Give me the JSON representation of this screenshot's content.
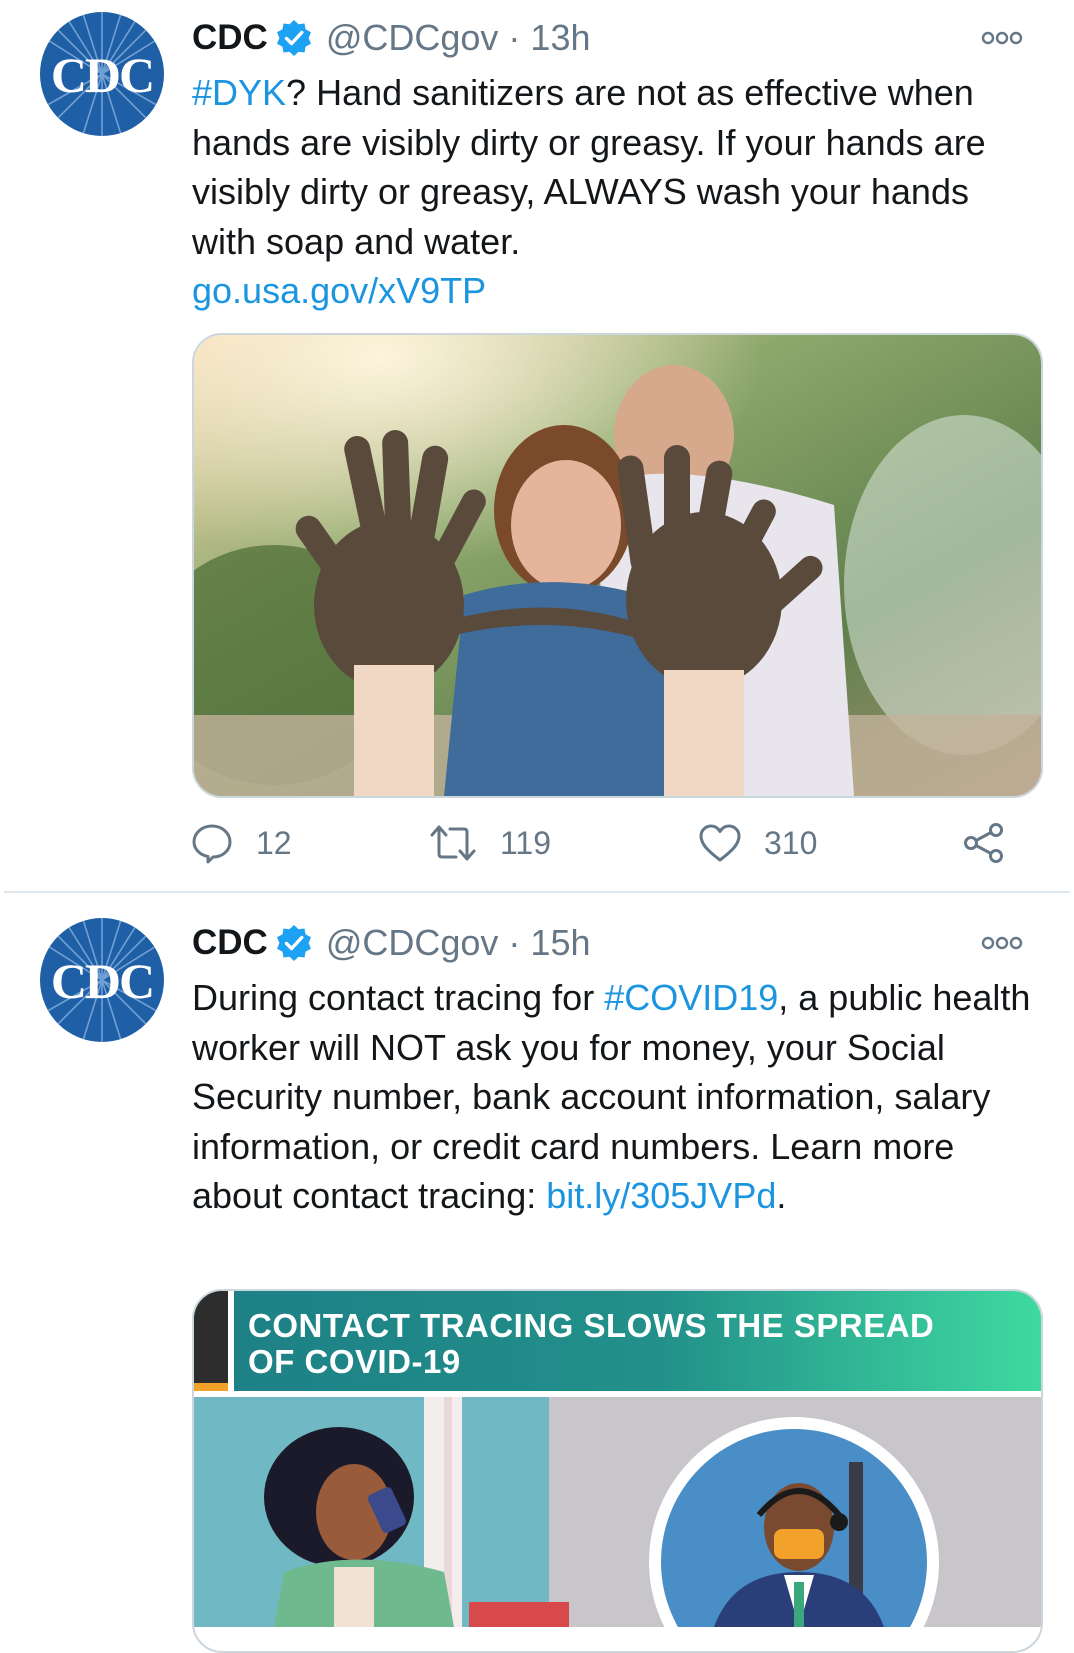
{
  "tweets": [
    {
      "author": {
        "name": "CDC",
        "handle": "@CDCgov",
        "avatar_label": "CDC",
        "verified": true
      },
      "time": "13h",
      "text_parts": {
        "hashtag": "#DYK",
        "rest": "? Hand sanitizers are not as effective when hands are visibly dirty or greasy. If your hands are visibly dirty or greasy, ALWAYS wash your hands with soap and water."
      },
      "link": "go.usa.gov/xV9TP",
      "media": {
        "kind": "photo",
        "description_icon": "muddy-hands-photo"
      },
      "stats": {
        "replies": "12",
        "retweets": "119",
        "likes": "310"
      }
    },
    {
      "author": {
        "name": "CDC",
        "handle": "@CDCgov",
        "avatar_label": "CDC",
        "verified": true
      },
      "time": "15h",
      "text_parts": {
        "before": "During contact tracing for ",
        "hashtag": "#COVID19",
        "after": ", a public health worker will NOT ask you for money, your Social Security number, bank account information, salary information, or credit card numbers. Learn more about contact tracing: ",
        "link": "bit.ly/305JVPd",
        "end": "."
      },
      "media": {
        "kind": "infographic",
        "headline_line1": "CONTACT TRACING SLOWS THE SPREAD",
        "headline_line2": "OF COVID-19"
      }
    }
  ],
  "colors": {
    "link": "#1b95e0",
    "verified": "#1da1f2",
    "secondary_text": "#657786",
    "cdc_blue": "#1f5fa6",
    "banner_teal": "#1d7f86",
    "banner_green": "#3fd9a0"
  },
  "icons": {
    "reply": "reply-icon",
    "retweet": "retweet-icon",
    "like": "heart-icon",
    "share": "share-icon",
    "more": "more-icon",
    "verified": "verified-badge-icon"
  }
}
